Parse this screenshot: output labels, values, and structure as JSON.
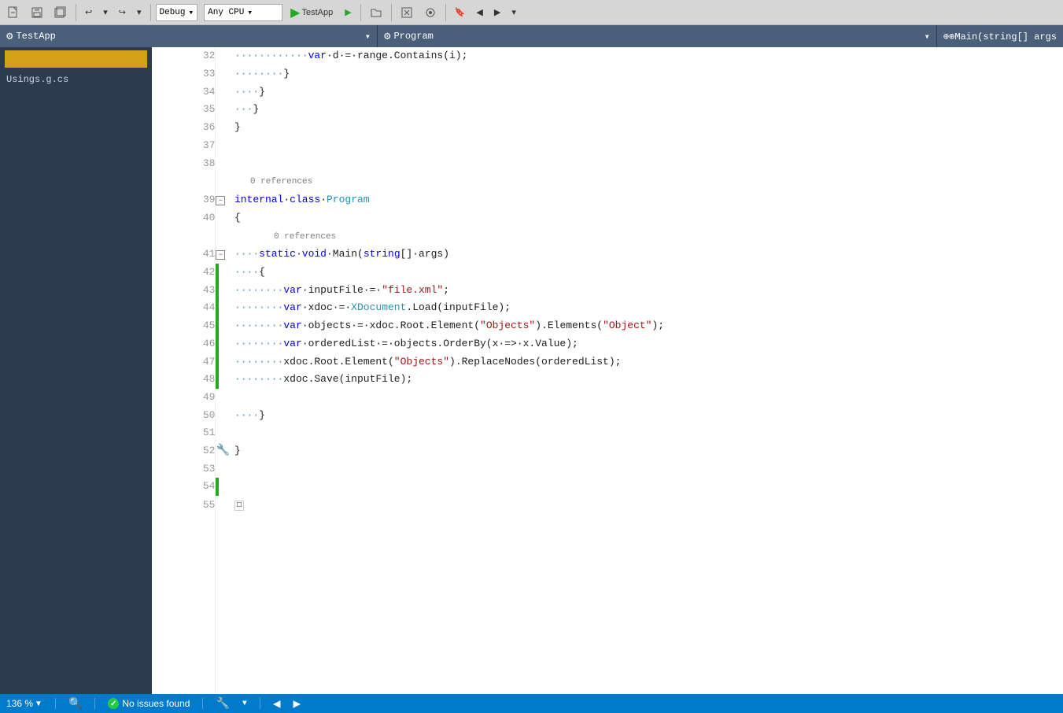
{
  "toolbar": {
    "config": "Debug",
    "platform": "Any CPU",
    "run_label": "TestApp",
    "icons": [
      "new-file",
      "save",
      "save-all",
      "undo",
      "redo",
      "open-file",
      "build",
      "attach",
      "bookmark",
      "nav-back",
      "nav-fwd"
    ]
  },
  "nav": {
    "file_label": "TestApp",
    "file_icon": "⚙",
    "member_label": "Program",
    "member_icon": "⚙",
    "nav_right": "⊕Main(string[] args"
  },
  "sidebar": {
    "yellow_bar": "",
    "items": [
      {
        "label": "Usings.g.cs"
      }
    ]
  },
  "editor": {
    "lines": [
      {
        "num": 32,
        "code": "        var·d·=·range.Contains(i);",
        "has_green": false
      },
      {
        "num": 33,
        "code": "        }",
        "has_green": false
      },
      {
        "num": 34,
        "code": "    }",
        "has_green": false
      },
      {
        "num": 35,
        "code": "···}",
        "has_green": false
      },
      {
        "num": 36,
        "code": "}",
        "has_green": false
      },
      {
        "num": 37,
        "code": "",
        "has_green": false
      },
      {
        "num": 38,
        "code": "",
        "has_green": false
      },
      {
        "num": "ref_39",
        "ref_text": "0 references",
        "code": "",
        "is_ref": true
      },
      {
        "num": 39,
        "code": "internal·class·Program",
        "has_green": false,
        "has_collapse": true
      },
      {
        "num": 40,
        "code": "{",
        "has_green": false
      },
      {
        "num": "ref_41",
        "ref_text": "0 references",
        "code": "",
        "is_ref": true,
        "indent": true
      },
      {
        "num": 41,
        "code": "    static·void·Main(string[]·args)",
        "has_green": false,
        "has_collapse": true
      },
      {
        "num": 42,
        "code": "    {",
        "has_green": true
      },
      {
        "num": 43,
        "code": "        var·inputFile·=·\"file.xml\";",
        "has_green": true
      },
      {
        "num": 44,
        "code": "        var·xdoc·=·XDocument.Load(inputFile);",
        "has_green": true
      },
      {
        "num": 45,
        "code": "        var·objects·=·xdoc.Root.Element(\"Objects\").Elements(\"Object\");",
        "has_green": true
      },
      {
        "num": 46,
        "code": "        var·orderedList·=·objects.OrderBy(x·=>·x.Value);",
        "has_green": true
      },
      {
        "num": 47,
        "code": "        xdoc.Root.Element(\"Objects\").ReplaceNodes(orderedList);",
        "has_green": true
      },
      {
        "num": 48,
        "code": "        xdoc.Save(inputFile);",
        "has_green": true
      },
      {
        "num": 49,
        "code": "",
        "has_green": false
      },
      {
        "num": 50,
        "code": "    }",
        "has_green": false
      },
      {
        "num": 51,
        "code": "",
        "has_green": false
      },
      {
        "num": 52,
        "code": "}",
        "has_green": false,
        "has_wrench": true
      },
      {
        "num": 53,
        "code": "",
        "has_green": false
      },
      {
        "num": 54,
        "code": "",
        "has_green": true
      },
      {
        "num": 55,
        "code": "□",
        "has_green": false
      }
    ]
  },
  "status_bar": {
    "zoom_value": "136 %",
    "zoom_dropdown_arrow": "▼",
    "issues_icon": "✓",
    "issues_text": "No issues found",
    "wrench_icon": "🔧",
    "settings_arrow": "▼",
    "nav_left": "◀",
    "nav_right": "▶"
  }
}
